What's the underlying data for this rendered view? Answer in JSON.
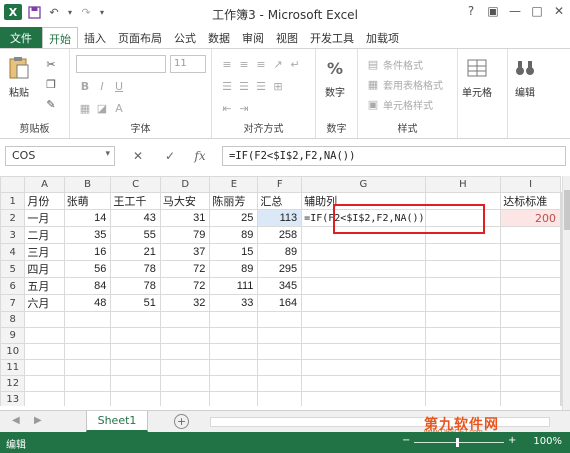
{
  "window": {
    "title": "工作簿3 - Microsoft Excel",
    "logo": "X",
    "buttons": [
      "?",
      "▣",
      "—",
      "□",
      "✕"
    ]
  },
  "ribbon": {
    "tabs": [
      "文件",
      "开始",
      "插入",
      "页面布局",
      "公式",
      "数据",
      "审阅",
      "视图",
      "开发工具",
      "加载项"
    ],
    "active_tab": "开始",
    "groups": {
      "clipboard": {
        "label": "剪贴板",
        "paste": "粘贴"
      },
      "font": {
        "label": "字体",
        "size": "11",
        "bold": "B",
        "italic": "I",
        "underline": "U",
        "font_color": "A"
      },
      "alignment": {
        "label": "对齐方式"
      },
      "number": {
        "label": "数字",
        "button": "数字",
        "percent": "%"
      },
      "styles": {
        "label": "样式",
        "items": [
          "条件格式",
          "套用表格格式",
          "单元格样式"
        ]
      },
      "cells": {
        "button": "单元格"
      },
      "editing": {
        "button": "编辑"
      }
    }
  },
  "formula_bar": {
    "name_box": "COS",
    "cancel": "✕",
    "confirm": "✓",
    "fx": "fx",
    "formula": "=IF(F2<$I$2,F2,NA())"
  },
  "sheet": {
    "columns": [
      "A",
      "B",
      "C",
      "D",
      "E",
      "F",
      "G",
      "H",
      "I"
    ],
    "rows": [
      [
        "月份",
        "张萌",
        "王工千",
        "马大安",
        "陈丽芳",
        "汇总",
        "辅助列",
        "",
        "达标标准"
      ],
      [
        "一月",
        "14",
        "43",
        "31",
        "25",
        "113",
        "=IF(F2<$I$2,F2,NA())",
        "",
        "200"
      ],
      [
        "二月",
        "35",
        "55",
        "79",
        "89",
        "258",
        "",
        "",
        ""
      ],
      [
        "三月",
        "16",
        "21",
        "37",
        "15",
        "89",
        "",
        "",
        ""
      ],
      [
        "四月",
        "56",
        "78",
        "72",
        "89",
        "295",
        "",
        "",
        ""
      ],
      [
        "五月",
        "84",
        "78",
        "72",
        "111",
        "345",
        "",
        "",
        ""
      ],
      [
        "六月",
        "48",
        "51",
        "32",
        "33",
        "164",
        "",
        "",
        ""
      ],
      [
        "",
        "",
        "",
        "",
        "",
        "",
        "",
        "",
        ""
      ],
      [
        "",
        "",
        "",
        "",
        "",
        "",
        "",
        "",
        ""
      ],
      [
        "",
        "",
        "",
        "",
        "",
        "",
        "",
        "",
        ""
      ],
      [
        "",
        "",
        "",
        "",
        "",
        "",
        "",
        "",
        ""
      ],
      [
        "",
        "",
        "",
        "",
        "",
        "",
        "",
        "",
        ""
      ],
      [
        "",
        "",
        "",
        "",
        "",
        "",
        "",
        "",
        ""
      ]
    ],
    "tab_name": "Sheet1",
    "add_sheet": "+"
  },
  "status_bar": {
    "mode": "编辑",
    "zoom": "100%",
    "zoom_minus": "−",
    "zoom_plus": "+"
  },
  "watermark": {
    "text": "第九软件网",
    "sub": "www.D9SOFT.com"
  },
  "colors": {
    "excel_green": "#217346",
    "highlight_red": "#e02020",
    "selection_blue": "#6f9edb"
  }
}
